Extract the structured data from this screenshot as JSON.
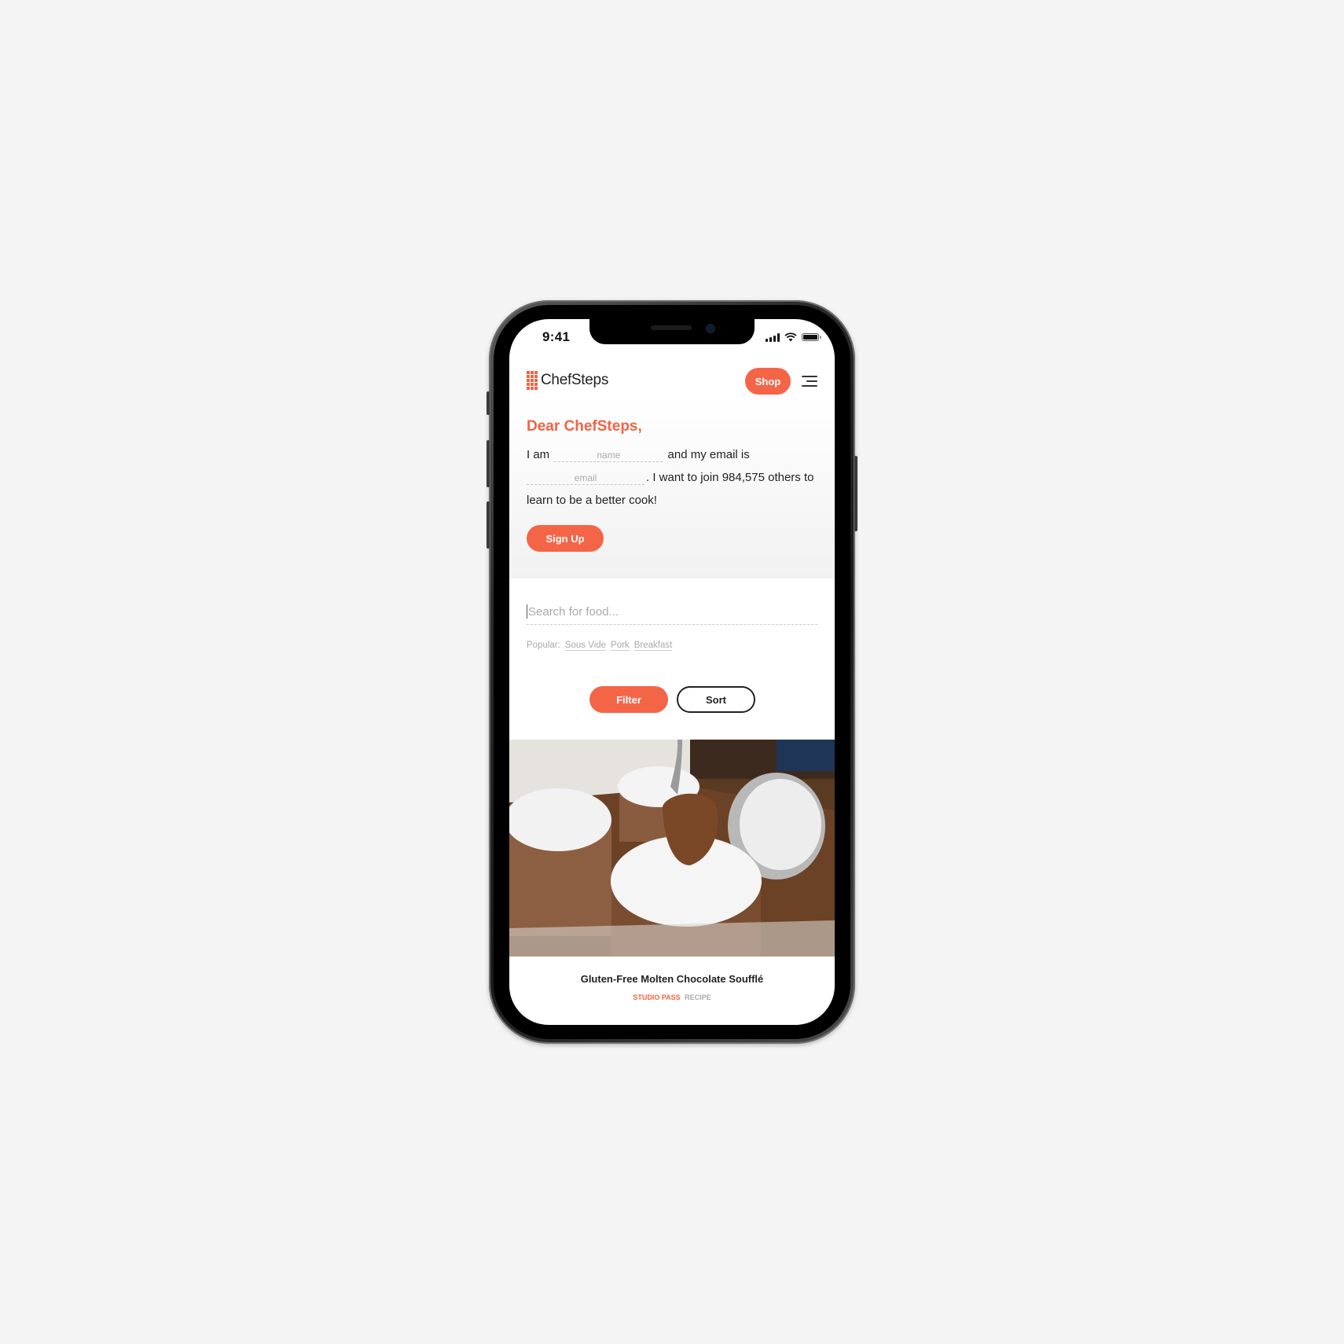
{
  "status_bar": {
    "time": "9:41",
    "icons": [
      "signal-icon",
      "wifi-icon",
      "battery-icon"
    ]
  },
  "header": {
    "logo_text": "ChefSteps",
    "shop_label": "Shop",
    "menu_icon": "hamburger-menu-icon"
  },
  "signup": {
    "greeting": "Dear ChefSteps,",
    "text_1": "I am",
    "name_placeholder": "name",
    "text_2": "and my email is",
    "email_placeholder": "email",
    "text_3": ". I want to join 984,575 others to learn to be a better cook!",
    "member_count": "984,575",
    "button_label": "Sign Up"
  },
  "search": {
    "placeholder": "Search for food...",
    "popular_label": "Popular:",
    "popular_tags": [
      "Sous Vide",
      "Pork",
      "Breakfast"
    ],
    "filter_label": "Filter",
    "sort_label": "Sort"
  },
  "recipe": {
    "image_alt": "Chocolate soufflés dusted with powdered sugar, spoon lifting molten center",
    "title": "Gluten-Free Molten Chocolate Soufflé",
    "tag_pass": "STUDIO PASS",
    "tag_type": "RECIPE"
  },
  "colors": {
    "accent": "#f46548",
    "text": "#222222",
    "muted": "#aaaaaa",
    "background": "#f4f4f4"
  }
}
